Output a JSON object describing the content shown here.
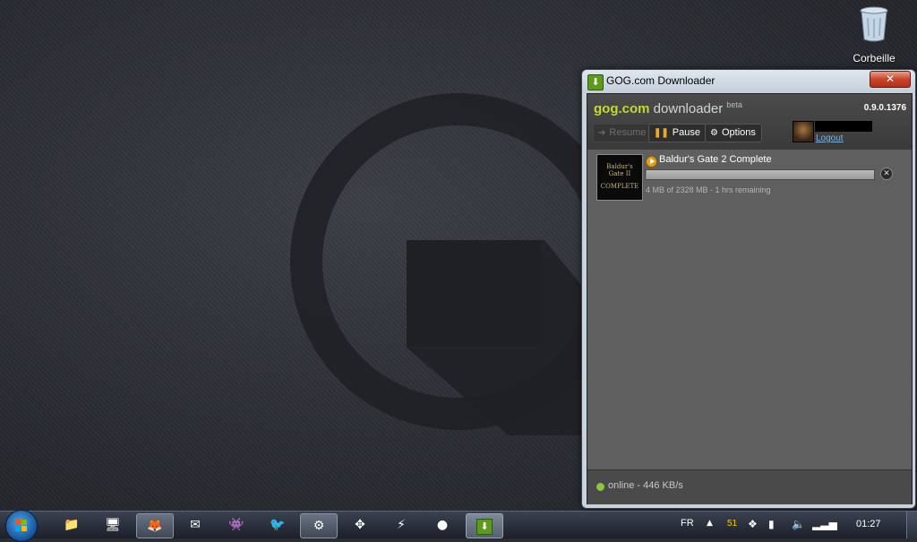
{
  "desktop": {
    "recycle_bin_label": "Corbeille"
  },
  "window": {
    "title": "GOG.com Downloader",
    "close_glyph": "✕",
    "app_logo": "gog.com",
    "app_logo_suffix": "downloader",
    "app_logo_sup": "beta",
    "version": "0.9.0.1376",
    "toolbar": {
      "resume_label": "Resume",
      "pause_label": "Pause",
      "options_label": "Options"
    },
    "account": {
      "logout_label": "Logout"
    },
    "downloads": [
      {
        "title": "Baldur's Gate 2 Complete",
        "thumb_line1": "Baldur's Gate II",
        "thumb_line2": "COMPLETE",
        "info": "4 MB of 2328 MB - 1 hrs remaining",
        "progress": 0.002
      }
    ],
    "status": "online - 446 KB/s"
  },
  "taskbar": {
    "language": "FR",
    "tray_count": "51",
    "clock": "01:27"
  },
  "colors": {
    "gog_green": "#5c9a1c",
    "logo_yellow": "#c5d92b",
    "online_green": "#8cc63f",
    "play_orange": "#e0a21a",
    "link_blue": "#7ab3e0"
  }
}
